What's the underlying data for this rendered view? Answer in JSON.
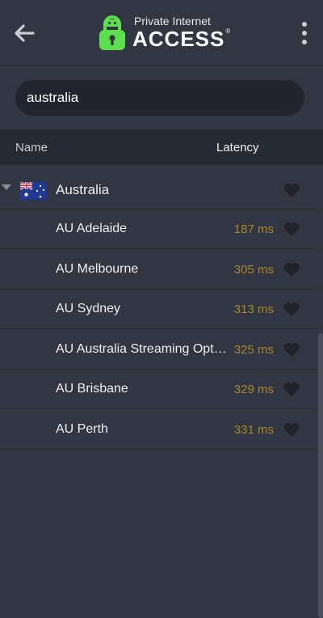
{
  "header": {
    "brand_small": "Private Internet",
    "brand_large": "ACCESS",
    "brand_mark": "®",
    "back_icon": "arrow-left-icon",
    "menu_icon": "kebab-menu-icon"
  },
  "search": {
    "value": "australia",
    "placeholder": ""
  },
  "columns": {
    "name": "Name",
    "latency": "Latency"
  },
  "group": {
    "label": "Australia",
    "flag_icon": "australia-flag-icon",
    "expanded": true
  },
  "regions": [
    {
      "label": "AU Adelaide",
      "latency": "187 ms"
    },
    {
      "label": "AU Melbourne",
      "latency": "305 ms"
    },
    {
      "label": "AU Sydney",
      "latency": "313 ms"
    },
    {
      "label": "AU Australia Streaming Optimized",
      "latency": "325 ms"
    },
    {
      "label": "AU Brisbane",
      "latency": "329 ms"
    },
    {
      "label": "AU Perth",
      "latency": "331 ms"
    }
  ],
  "colors": {
    "background": "#323642",
    "header_bar": "#262a33",
    "latency": "#a8882e",
    "brand_green": "#5ddf4f"
  }
}
